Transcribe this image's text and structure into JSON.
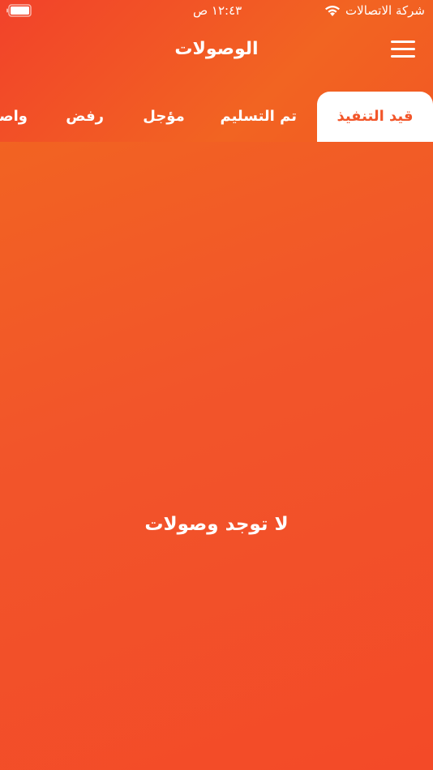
{
  "status_bar": {
    "carrier": "شركة الاتصالات",
    "time": "١٢:٤٣ ص"
  },
  "header": {
    "title": "الوصولات",
    "menu_icon": "hamburger-menu-icon"
  },
  "tabs": [
    {
      "label": "قيد التنفيذ",
      "active": true
    },
    {
      "label": "تم التسليم",
      "active": false
    },
    {
      "label": "مؤجل",
      "active": false
    },
    {
      "label": "رفض",
      "active": false
    },
    {
      "label": "واصل",
      "active": false
    }
  ],
  "main": {
    "empty_message": "لا توجد وصولات"
  },
  "colors": {
    "accent": "#f2562a",
    "tab_active_bg": "#ffffff"
  }
}
